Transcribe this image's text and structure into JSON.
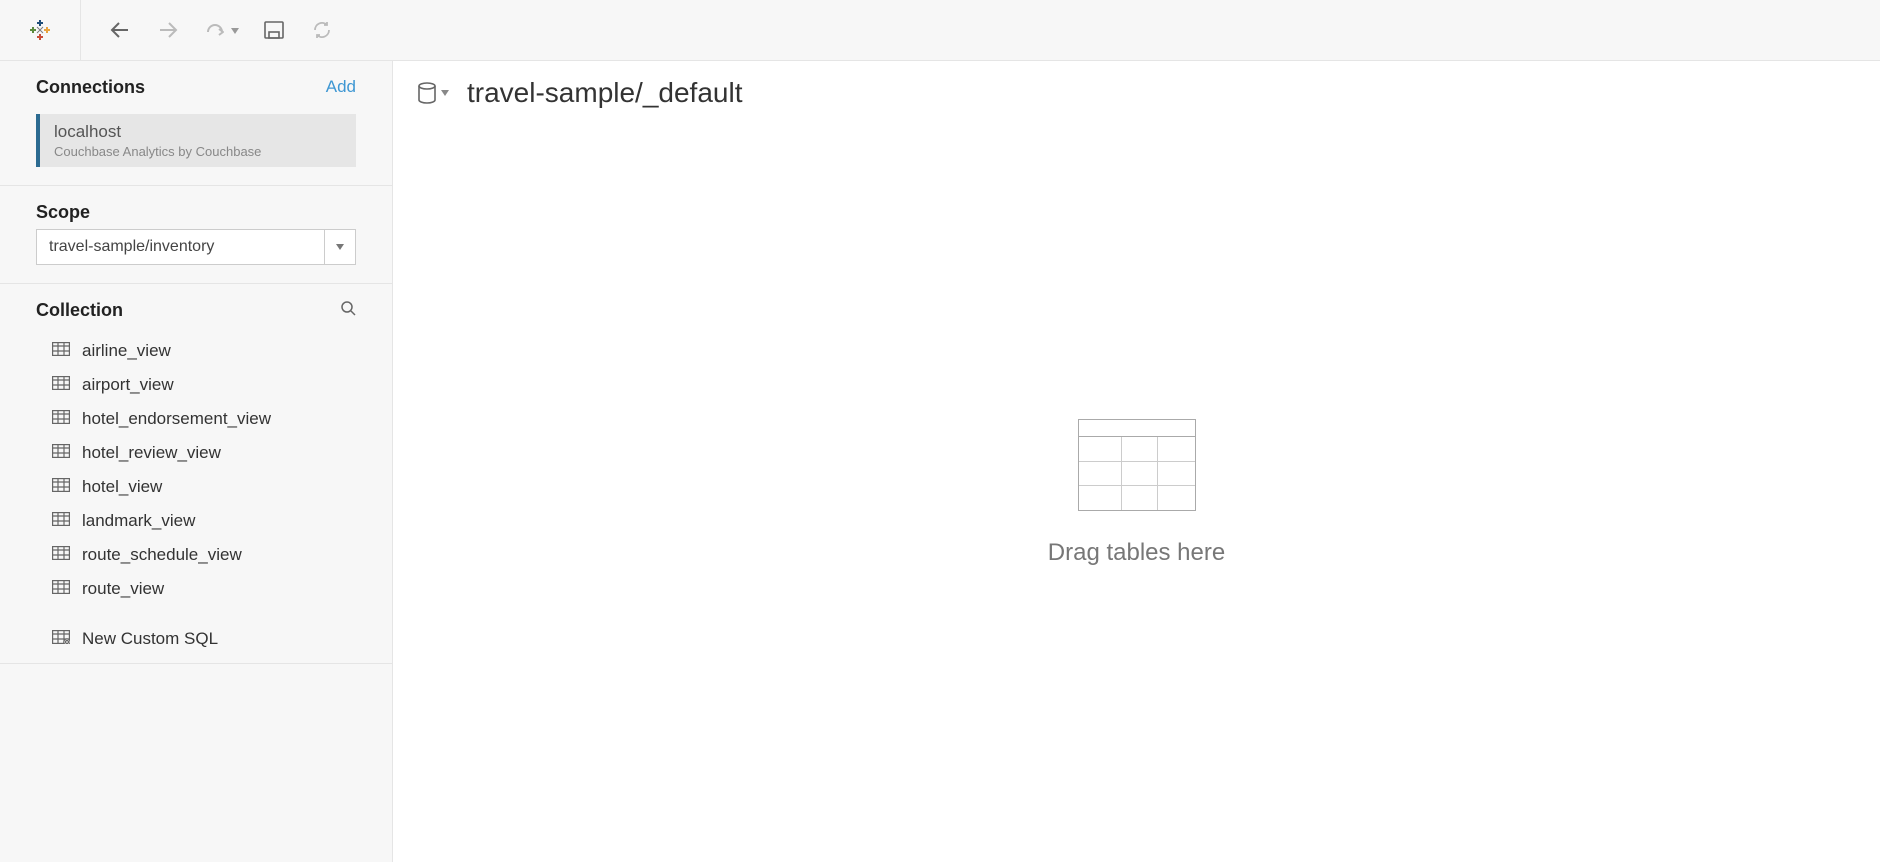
{
  "datasource": {
    "title": "travel-sample/_default"
  },
  "sidebar": {
    "connections": {
      "title": "Connections",
      "add_label": "Add",
      "items": [
        {
          "name": "localhost",
          "driver": "Couchbase Analytics by Couchbase"
        }
      ]
    },
    "scope": {
      "title": "Scope",
      "value": "travel-sample/inventory"
    },
    "collection": {
      "title": "Collection",
      "items": [
        {
          "label": "airline_view"
        },
        {
          "label": "airport_view"
        },
        {
          "label": "hotel_endorsement_view"
        },
        {
          "label": "hotel_review_view"
        },
        {
          "label": "hotel_view"
        },
        {
          "label": "landmark_view"
        },
        {
          "label": "route_schedule_view"
        },
        {
          "label": "route_view"
        }
      ],
      "custom_sql_label": "New Custom SQL"
    }
  },
  "canvas": {
    "drag_label": "Drag tables here"
  }
}
